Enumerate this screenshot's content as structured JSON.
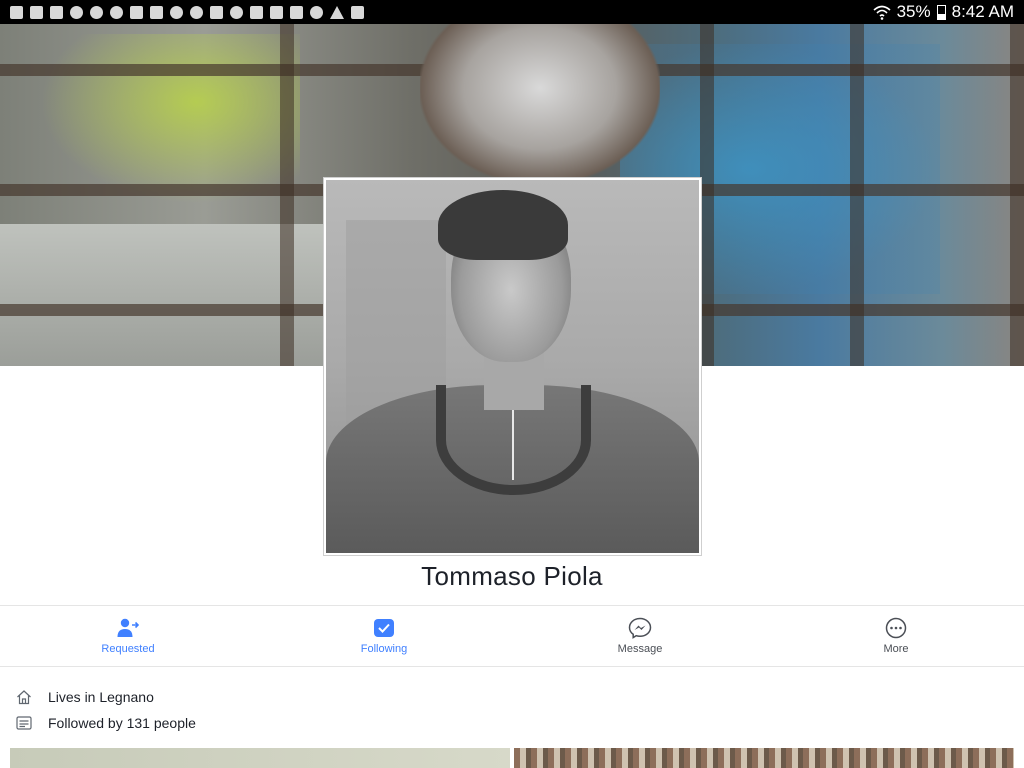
{
  "status_bar": {
    "left_icons": [
      "shield-icon",
      "shield-icon",
      "shield-icon",
      "bell-icon",
      "chess-pawn-icon",
      "chess-pawn-icon",
      "wrench-icon",
      "wrench-icon",
      "chess-pawn-icon",
      "chess-pawn-icon",
      "image-icon",
      "weather-icon",
      "flag-icon",
      "shield-icon",
      "notes-icon",
      "dollar-icon",
      "warning-icon",
      "google-plus-icon"
    ],
    "battery": "35%",
    "time": "8:42 AM"
  },
  "profile": {
    "name": "Tommaso Piola"
  },
  "actions": [
    {
      "label": "Requested",
      "icon": "add-friend-icon",
      "active": true
    },
    {
      "label": "Following",
      "icon": "following-check-icon",
      "active": true
    },
    {
      "label": "Message",
      "icon": "messenger-icon",
      "active": false
    },
    {
      "label": "More",
      "icon": "more-dots-icon",
      "active": false
    }
  ],
  "info": {
    "lives_in": "Lives in Legnano",
    "followed_by": "Followed by 131 people"
  },
  "colors": {
    "accent": "#4080ff",
    "text": "#1d2129",
    "muted": "#4b4f56"
  }
}
